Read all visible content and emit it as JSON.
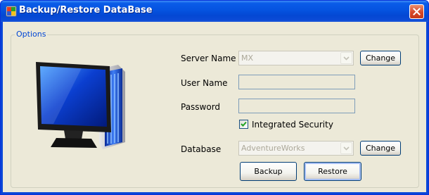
{
  "window": {
    "title": "Backup/Restore DataBase",
    "app_icon": "database-app-icon",
    "close_icon": "close-icon"
  },
  "options_group": {
    "label": "Options"
  },
  "illustration": {
    "icon": "computer-monitor-icon"
  },
  "server_name": {
    "label": "Server Name",
    "value": "MX",
    "change_label": "Change"
  },
  "user_name": {
    "label": "User Name",
    "value": ""
  },
  "password": {
    "label": "Password",
    "value": ""
  },
  "integrated_security": {
    "label": "Integrated Security",
    "checked": true
  },
  "database": {
    "label": "Database",
    "value": "AdventureWorks",
    "change_label": "Change"
  },
  "actions": {
    "backup_label": "Backup",
    "restore_label": "Restore"
  },
  "colors": {
    "titlebar": "#0553e0",
    "client_bg": "#ece9d8",
    "group_title": "#0046d5",
    "disabled_text": "#aca899"
  }
}
